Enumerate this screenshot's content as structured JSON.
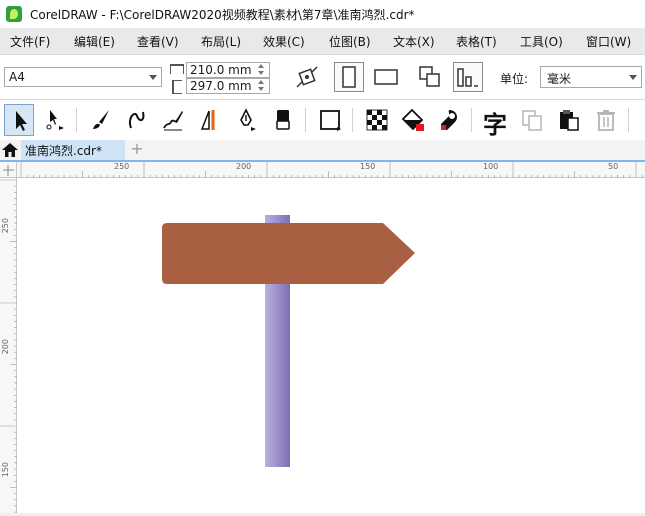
{
  "app": {
    "title": "CorelDRAW - F:\\CorelDRAW2020视频教程\\素材\\第7章\\准南鸿烈.cdr*",
    "icon": "coreldraw-logo-icon"
  },
  "menu": [
    {
      "label": "文件(F)"
    },
    {
      "label": "编辑(E)"
    },
    {
      "label": "查看(V)"
    },
    {
      "label": "布局(L)"
    },
    {
      "label": "效果(C)"
    },
    {
      "label": "位图(B)"
    },
    {
      "label": "文本(X)"
    },
    {
      "label": "表格(T)"
    },
    {
      "label": "工具(O)"
    },
    {
      "label": "窗口(W)"
    }
  ],
  "property_bar": {
    "page_size": "A4",
    "width": "210.0 mm",
    "height": "297.0 mm",
    "unit_label": "单位:",
    "unit_value": "毫米"
  },
  "toolbox": {
    "tools": [
      "pick-tool-icon",
      "shape-tool-icon",
      "artistic-media-icon",
      "freehand-icon",
      "calligraphy-icon",
      "perspective-icon",
      "pen-tool-icon",
      "eraser-icon",
      "rectangle-tool-icon",
      "transparency-icon",
      "fill-tool-icon",
      "color-eyedropper-icon",
      "text-tool-icon",
      "copy-icon",
      "paste-icon",
      "delete-icon"
    ],
    "text_tool_glyph": "字"
  },
  "tabs": {
    "document": "准南鸿烈.cdr*",
    "add": "+"
  },
  "rulers": {
    "horizontal_labels": [
      "250",
      "200",
      "150",
      "100",
      "50"
    ],
    "vertical_labels": [
      "250",
      "200",
      "150"
    ]
  },
  "colors": {
    "sign_board": "#a95f42",
    "post_light": "#b9b0de",
    "post_dark": "#7d6fb5",
    "accent_blue": "#7fb8e6"
  }
}
